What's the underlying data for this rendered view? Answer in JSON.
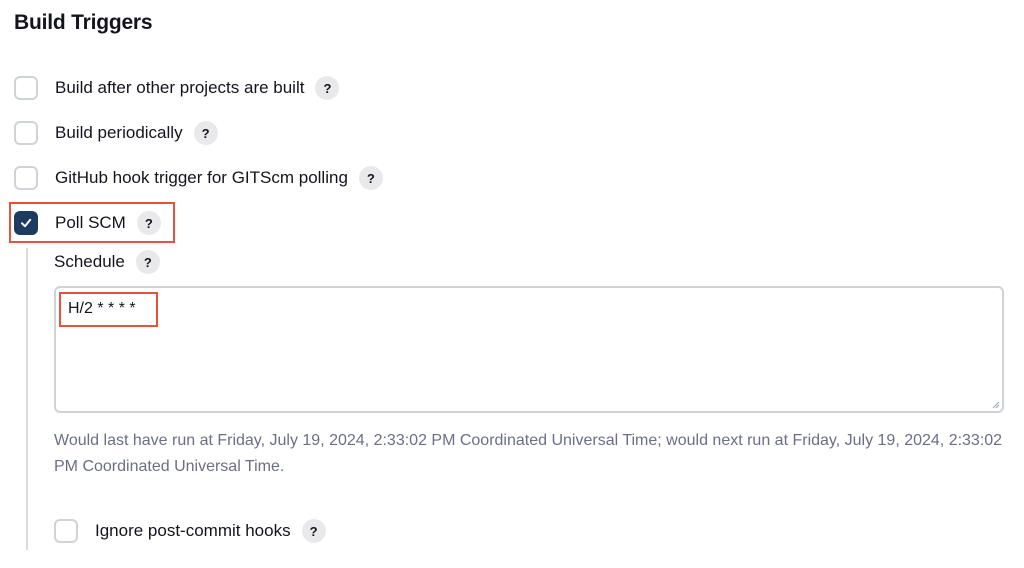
{
  "section": {
    "title": "Build Triggers"
  },
  "triggers": [
    {
      "label": "Build after other projects are built",
      "checked": false,
      "help": "?"
    },
    {
      "label": "Build periodically",
      "checked": false,
      "help": "?"
    },
    {
      "label": "GitHub hook trigger for GITScm polling",
      "checked": false,
      "help": "?"
    },
    {
      "label": "Poll SCM",
      "checked": true,
      "help": "?"
    }
  ],
  "poll_scm": {
    "schedule_label": "Schedule",
    "schedule_help": "?",
    "schedule_value": "H/2 * * * *",
    "hint": "Would last have run at Friday, July 19, 2024, 2:33:02 PM Coordinated Universal Time; would next run at Friday, July 19, 2024, 2:33:02 PM Coordinated Universal Time.",
    "ignore_hooks": {
      "label": "Ignore post-commit hooks",
      "checked": false,
      "help": "?"
    }
  },
  "colors": {
    "checked_fill": "#1d3a5f",
    "highlight": "#e5533a",
    "hint_text": "#6b6f86"
  },
  "icons": {
    "check": "check-icon",
    "help": "question-mark-icon"
  }
}
